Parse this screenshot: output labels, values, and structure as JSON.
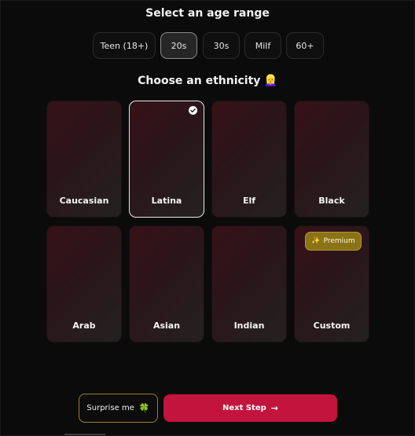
{
  "age_section": {
    "title": "Select an age range",
    "options": [
      {
        "label": "Teen (18+)"
      },
      {
        "label": "20s",
        "selected": true
      },
      {
        "label": "30s"
      },
      {
        "label": "Milf"
      },
      {
        "label": "60+"
      }
    ]
  },
  "ethnicity_section": {
    "title": "Choose an ethnicity",
    "title_emoji": "👱‍♀️",
    "options": [
      {
        "label": "Caucasian"
      },
      {
        "label": "Latina",
        "selected": true
      },
      {
        "label": "Elf"
      },
      {
        "label": "Black"
      },
      {
        "label": "Arab"
      },
      {
        "label": "Asian"
      },
      {
        "label": "Indian"
      },
      {
        "label": "Custom",
        "badge": "Premium"
      }
    ]
  },
  "actions": {
    "surprise_label": "Surprise me",
    "surprise_emoji": "🍀",
    "next_label": "Next Step",
    "next_arrow": "→"
  },
  "colors": {
    "background": "#0b0b0b",
    "primary_button": "#c2143c",
    "premium_badge": "#8a7316",
    "card_gradient_start": "#361118"
  },
  "icons": {
    "selected_check": "check-circle-icon",
    "premium": "sparkle-icon",
    "next": "arrow-right-icon",
    "surprise": "clover-icon"
  }
}
